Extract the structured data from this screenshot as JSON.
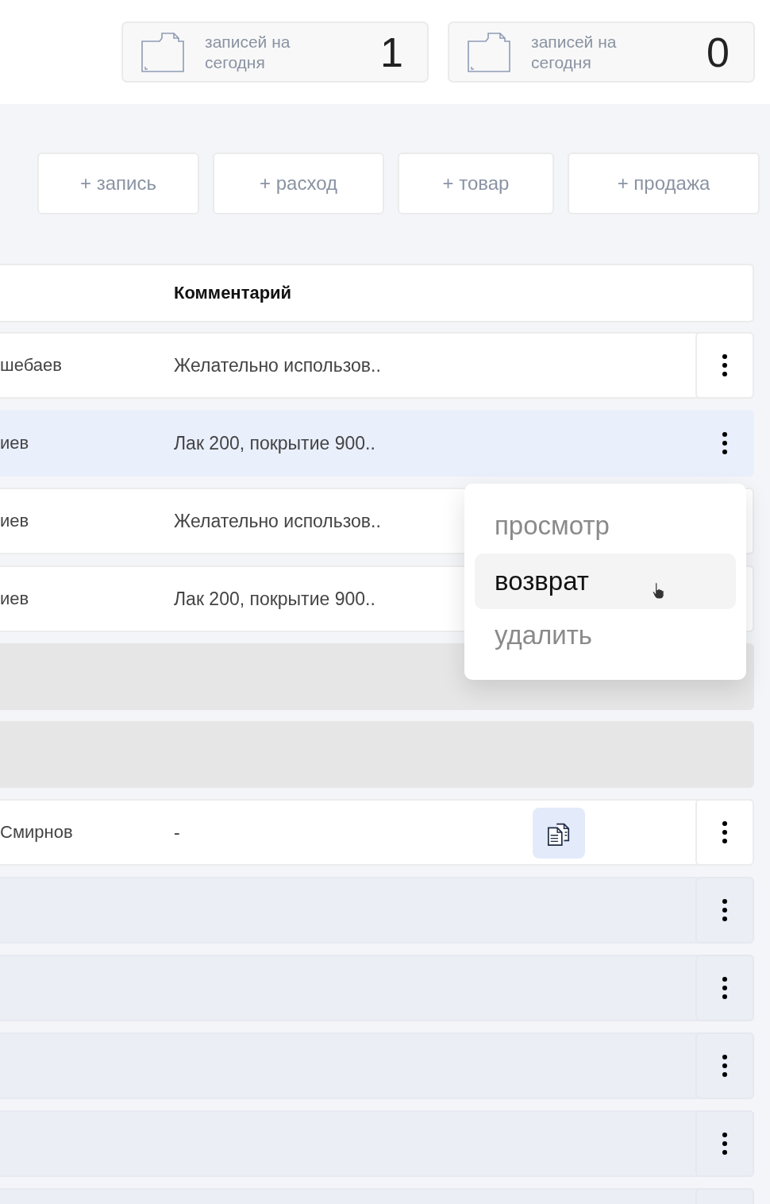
{
  "stats": [
    {
      "label": "записей на сегодня",
      "value": "1"
    },
    {
      "label": "записей на сегодня",
      "value": "0"
    }
  ],
  "actions": [
    "+ запись",
    "+ расход",
    "+ товар",
    "+ продажа"
  ],
  "table": {
    "columns": [
      "Комментарий"
    ],
    "rows": [
      {
        "kind": "normal",
        "name": "шебаев",
        "comment": "Желательно использов..",
        "selected": false,
        "document": false
      },
      {
        "kind": "normal",
        "name": "иев",
        "comment": "Лак 200, покрытие 900..",
        "selected": true,
        "document": false
      },
      {
        "kind": "normal",
        "name": "иев",
        "comment": "Желательно использов..",
        "selected": false,
        "document": false
      },
      {
        "kind": "normal",
        "name": "иев",
        "comment": "Лак 200, покрытие 900..",
        "selected": false,
        "document": false
      },
      {
        "kind": "loading"
      },
      {
        "kind": "loading"
      },
      {
        "kind": "normal",
        "name": "Смирнов",
        "comment": "-",
        "selected": false,
        "document": true
      },
      {
        "kind": "empty"
      },
      {
        "kind": "empty"
      },
      {
        "kind": "empty"
      },
      {
        "kind": "empty"
      },
      {
        "kind": "empty"
      }
    ]
  },
  "context_menu": [
    {
      "label": "просмотр",
      "selected": false
    },
    {
      "label": "возврат",
      "selected": true
    },
    {
      "label": "удалить",
      "selected": false
    }
  ]
}
